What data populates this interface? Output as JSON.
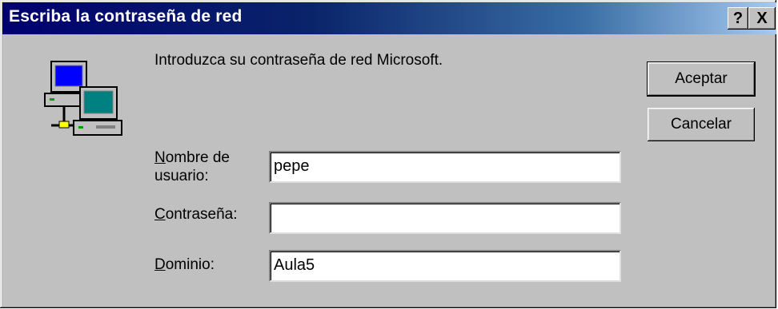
{
  "window": {
    "title": "Escriba la contraseña de red",
    "help_button": "?",
    "close_button": "X"
  },
  "dialog": {
    "prompt": "Introduzca su contraseña de red Microsoft.",
    "icon": "network-computers-icon"
  },
  "fields": {
    "username": {
      "label_first": "N",
      "label_rest": "ombre de usuario:",
      "value": "pepe"
    },
    "password": {
      "label_first": "C",
      "label_rest": "ontraseña:",
      "value": ""
    },
    "domain": {
      "label_first": "D",
      "label_rest": "ominio:",
      "value": "Aula5"
    }
  },
  "buttons": {
    "ok": "Aceptar",
    "cancel": "Cancelar"
  },
  "colors": {
    "titlebar_start": "#00006e",
    "titlebar_end": "#a6caf0",
    "face": "#c0c0c0"
  }
}
